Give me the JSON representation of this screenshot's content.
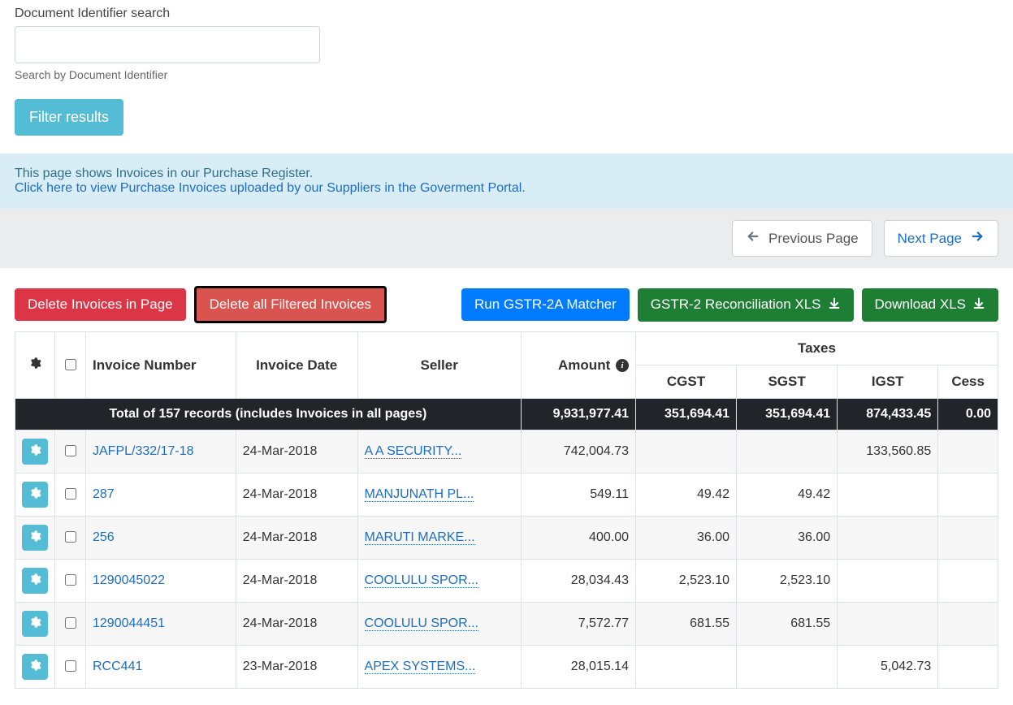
{
  "search": {
    "label": "Document Identifier search",
    "help": "Search by Document Identifier",
    "value": ""
  },
  "buttons": {
    "filter": "Filter results",
    "delete_page": "Delete Invoices in Page",
    "delete_filtered": "Delete all Filtered Invoices",
    "run_matcher": "Run GSTR-2A Matcher",
    "recon_xls": "GSTR-2 Reconciliation XLS",
    "download_xls": "Download XLS",
    "prev": "Previous Page",
    "next": "Next Page"
  },
  "info": {
    "text": "This page shows Invoices in our Purchase Register.",
    "link": "Click here to view Purchase Invoices uploaded by our Suppliers in the Goverment Portal."
  },
  "headers": {
    "invoice_no": "Invoice Number",
    "invoice_date": "Invoice Date",
    "seller": "Seller",
    "amount": "Amount",
    "taxes": "Taxes",
    "cgst": "CGST",
    "sgst": "SGST",
    "igst": "IGST",
    "cess": "Cess"
  },
  "totals": {
    "label": "Total of 157 records (includes Invoices in all pages)",
    "amount": "9,931,977.41",
    "cgst": "351,694.41",
    "sgst": "351,694.41",
    "igst": "874,433.45",
    "cess": "0.00"
  },
  "rows": [
    {
      "invoice_no": "JAFPL/332/17-18",
      "date": "24-Mar-2018",
      "seller": "A A SECURITY...",
      "amount": "742,004.73",
      "cgst": "",
      "sgst": "",
      "igst": "133,560.85",
      "cess": ""
    },
    {
      "invoice_no": "287",
      "date": "24-Mar-2018",
      "seller": "MANJUNATH PL...",
      "amount": "549.11",
      "cgst": "49.42",
      "sgst": "49.42",
      "igst": "",
      "cess": ""
    },
    {
      "invoice_no": "256",
      "date": "24-Mar-2018",
      "seller": "MARUTI MARKE...",
      "amount": "400.00",
      "cgst": "36.00",
      "sgst": "36.00",
      "igst": "",
      "cess": ""
    },
    {
      "invoice_no": "1290045022",
      "date": "24-Mar-2018",
      "seller": "COOLULU SPOR...",
      "amount": "28,034.43",
      "cgst": "2,523.10",
      "sgst": "2,523.10",
      "igst": "",
      "cess": ""
    },
    {
      "invoice_no": "1290044451",
      "date": "24-Mar-2018",
      "seller": "COOLULU SPOR...",
      "amount": "7,572.77",
      "cgst": "681.55",
      "sgst": "681.55",
      "igst": "",
      "cess": ""
    },
    {
      "invoice_no": "RCC441",
      "date": "23-Mar-2018",
      "seller": "APEX SYSTEMS...",
      "amount": "28,015.14",
      "cgst": "",
      "sgst": "",
      "igst": "5,042.73",
      "cess": ""
    }
  ]
}
